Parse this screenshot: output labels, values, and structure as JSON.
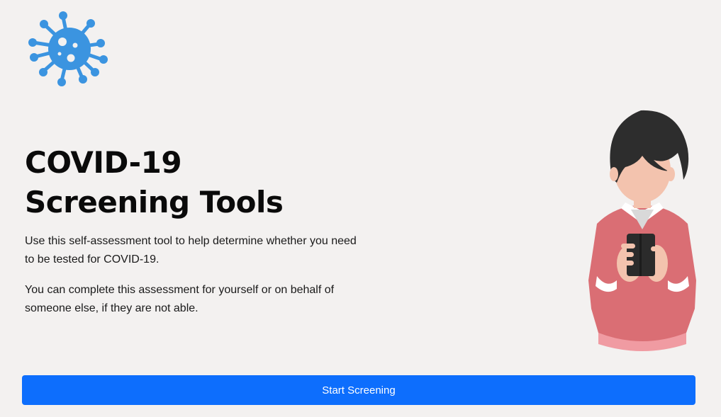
{
  "brand": {
    "logo_icon": "virus-icon",
    "accent_color": "#3b94e0"
  },
  "hero": {
    "title_line_1": "COVID-19",
    "title_line_2": "Screening Tools",
    "paragraph_1": "Use this self-assessment tool to help determine whether you need to be tested for COVID-19.",
    "paragraph_2": "You can complete this assessment for yourself or on behalf of someone else, if they are not able."
  },
  "illustration": {
    "icon": "person-holding-phone-illustration"
  },
  "actions": {
    "start_label": "Start Screening",
    "button_color": "#0d6efd"
  }
}
